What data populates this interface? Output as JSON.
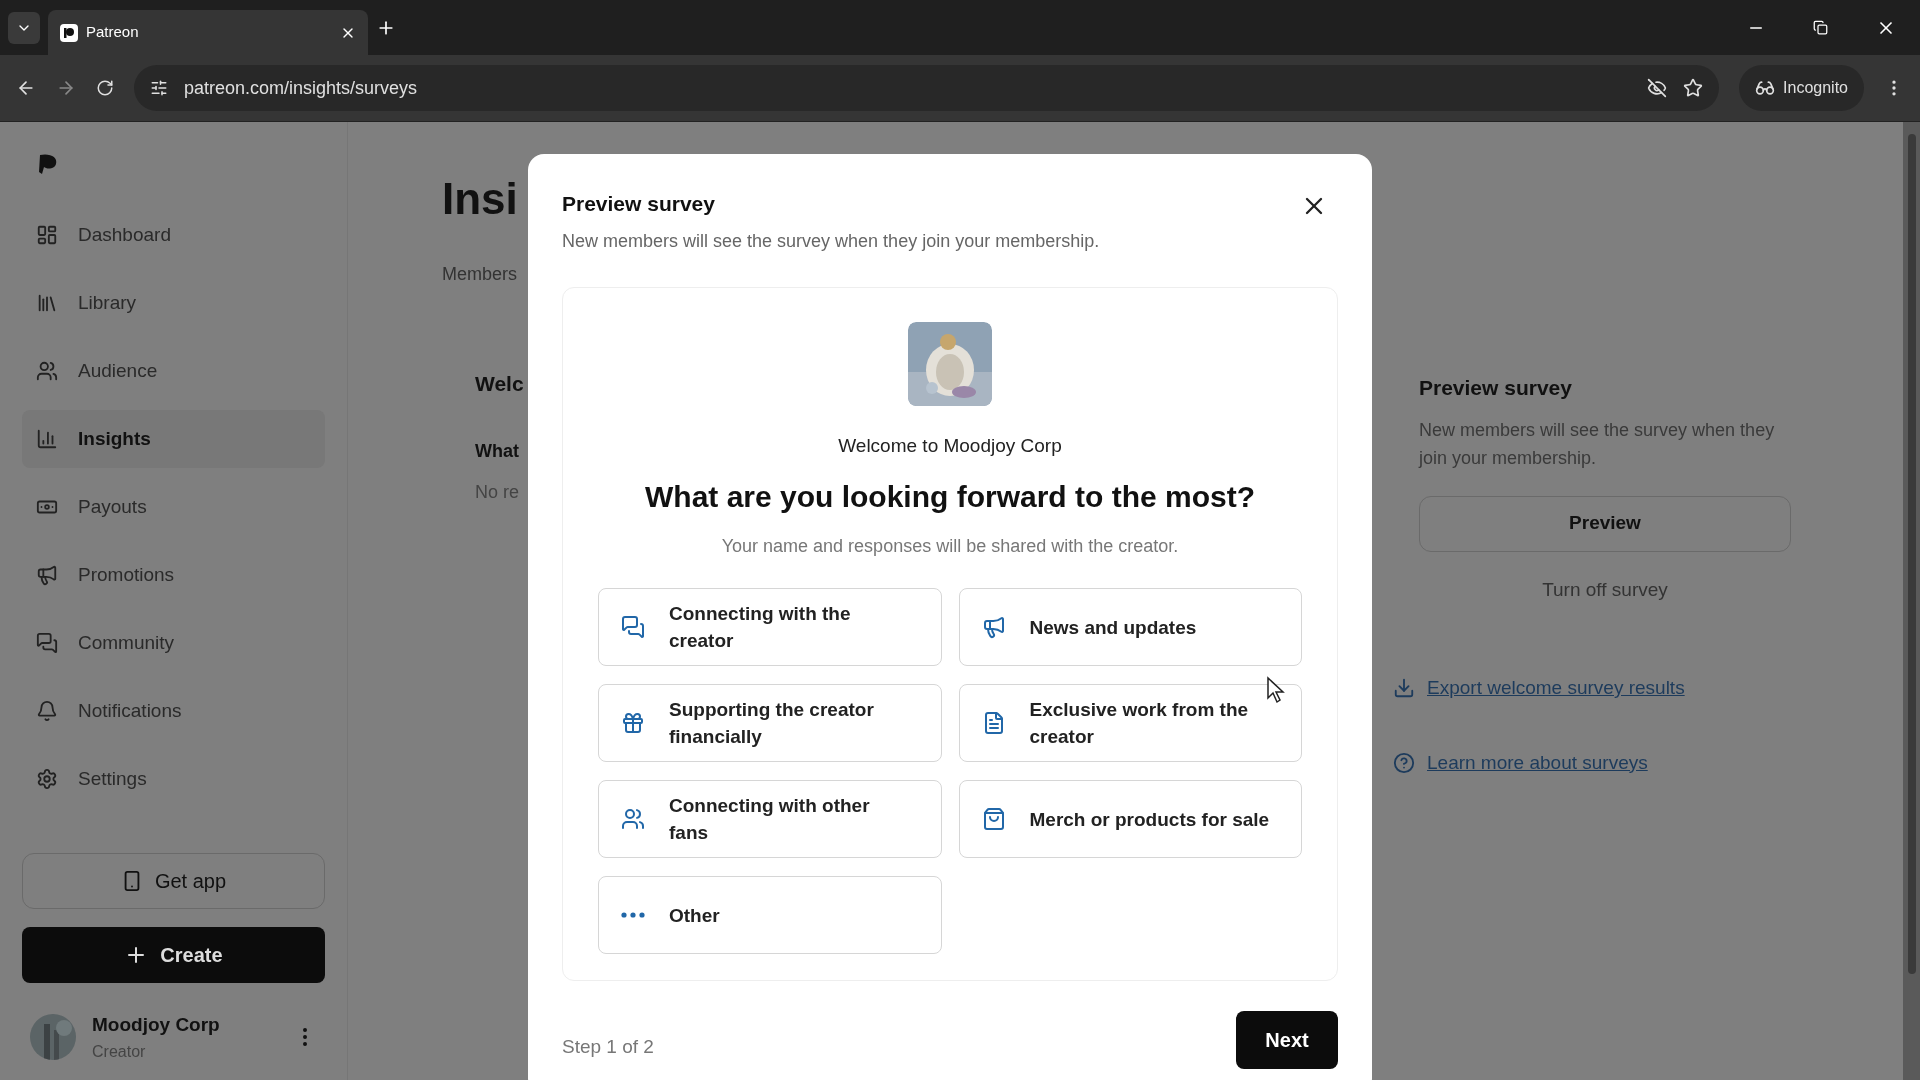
{
  "browser": {
    "tab_title": "Patreon",
    "url": "patreon.com/insights/surveys",
    "profile_label": "Incognito"
  },
  "sidebar": {
    "items": [
      {
        "label": "Dashboard",
        "kind": "dashboard",
        "selected": false
      },
      {
        "label": "Library",
        "kind": "library",
        "selected": false
      },
      {
        "label": "Audience",
        "kind": "audience",
        "selected": false
      },
      {
        "label": "Insights",
        "kind": "insights",
        "selected": true
      },
      {
        "label": "Payouts",
        "kind": "payouts",
        "selected": false
      },
      {
        "label": "Promotions",
        "kind": "promotions",
        "selected": false
      },
      {
        "label": "Community",
        "kind": "community",
        "selected": false
      },
      {
        "label": "Notifications",
        "kind": "notifications",
        "selected": false
      },
      {
        "label": "Settings",
        "kind": "settings",
        "selected": false
      }
    ],
    "get_app": "Get app",
    "create": "Create",
    "user": {
      "name": "Moodjoy Corp",
      "role": "Creator"
    }
  },
  "page": {
    "heading": "Insi",
    "tab": "Members",
    "card_title": "Welc",
    "question": "What",
    "empty": "No re"
  },
  "side_panel": {
    "title": "Preview survey",
    "description": "New members will see the survey when they join your membership.",
    "preview_button": "Preview",
    "turn_off": "Turn off survey",
    "links": [
      {
        "label": "Export welcome survey results",
        "kind": "download"
      },
      {
        "label": "Learn more about surveys",
        "kind": "help"
      }
    ]
  },
  "modal": {
    "title": "Preview survey",
    "subtitle": "New members will see the survey when they join your membership.",
    "welcome": "Welcome to Moodjoy Corp",
    "question": "What are you looking forward to the most?",
    "note": "Your name and responses will be shared with the creator.",
    "options": [
      {
        "label": "Connecting with the creator",
        "kind": "chat"
      },
      {
        "label": "News and updates",
        "kind": "megaphone"
      },
      {
        "label": "Supporting the creator financially",
        "kind": "gift"
      },
      {
        "label": "Exclusive work from the creator",
        "kind": "document"
      },
      {
        "label": "Connecting with other fans",
        "kind": "group"
      },
      {
        "label": "Merch or products for sale",
        "kind": "bag"
      },
      {
        "label": "Other",
        "kind": "more"
      }
    ],
    "step": "Step 1 of 2",
    "next": "Next"
  }
}
